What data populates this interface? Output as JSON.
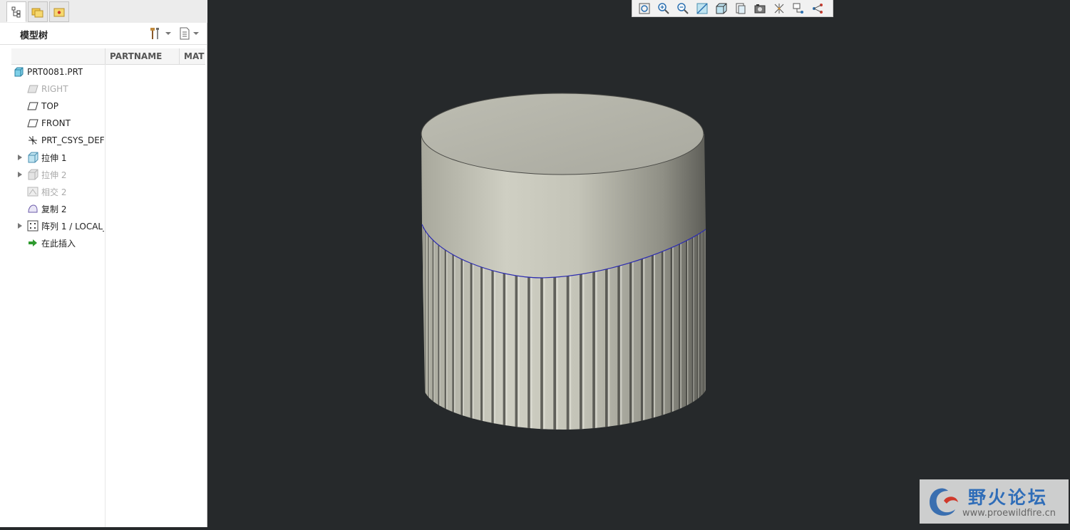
{
  "left_panel": {
    "tabs": [
      {
        "name": "model-tree-tab",
        "icon": "model-tree-icon"
      },
      {
        "name": "folder-browser-tab",
        "icon": "folder-browser-icon"
      },
      {
        "name": "favorites-tab",
        "icon": "favorites-icon"
      }
    ],
    "title": "模型树",
    "columns": [
      "PARTNAME",
      "MAT"
    ],
    "tree": [
      {
        "label": "PRT0081.PRT",
        "icon": "part-icon",
        "dim": false,
        "expandable": false
      },
      {
        "label": "RIGHT",
        "icon": "datum-plane-icon",
        "dim": true,
        "expandable": false
      },
      {
        "label": "TOP",
        "icon": "datum-plane-icon",
        "dim": false,
        "expandable": false
      },
      {
        "label": "FRONT",
        "icon": "datum-plane-icon",
        "dim": false,
        "expandable": false
      },
      {
        "label": "PRT_CSYS_DEF",
        "icon": "csys-icon",
        "dim": false,
        "expandable": false
      },
      {
        "label": "拉伸 1",
        "icon": "extrude-icon",
        "dim": false,
        "expandable": true
      },
      {
        "label": "拉伸 2",
        "icon": "extrude-icon",
        "dim": true,
        "expandable": true
      },
      {
        "label": "相交 2",
        "icon": "intersect-icon",
        "dim": true,
        "expandable": false
      },
      {
        "label": "复制 2",
        "icon": "copy-surface-icon",
        "dim": false,
        "expandable": false
      },
      {
        "label": "阵列 1 / LOCAL_",
        "icon": "pattern-icon",
        "dim": false,
        "expandable": true
      },
      {
        "label": "在此插入",
        "icon": "insert-here-icon",
        "dim": false,
        "expandable": false
      }
    ]
  },
  "view_toolbar": [
    {
      "name": "refit",
      "icon": "refit-icon"
    },
    {
      "name": "zoom-in",
      "icon": "zoom-in-icon"
    },
    {
      "name": "zoom-out",
      "icon": "zoom-out-icon"
    },
    {
      "name": "repaint",
      "icon": "repaint-icon"
    },
    {
      "name": "display-style",
      "icon": "display-style-icon"
    },
    {
      "name": "saved-orientations",
      "icon": "saved-orientations-icon"
    },
    {
      "name": "view-manager",
      "icon": "view-manager-icon"
    },
    {
      "name": "datum-display",
      "icon": "datum-display-icon"
    },
    {
      "name": "annotation-display",
      "icon": "annotation-display-icon"
    },
    {
      "name": "spin-center",
      "icon": "spin-center-icon"
    }
  ],
  "colors": {
    "viewport_bg": "#26292b",
    "model_surface": "#c8c8bc",
    "edge_highlight": "#2b2bb0",
    "watermark_blue": "#2f6db8"
  },
  "watermark": {
    "title": "野火论坛",
    "url": "www.proewildfire.cn"
  }
}
